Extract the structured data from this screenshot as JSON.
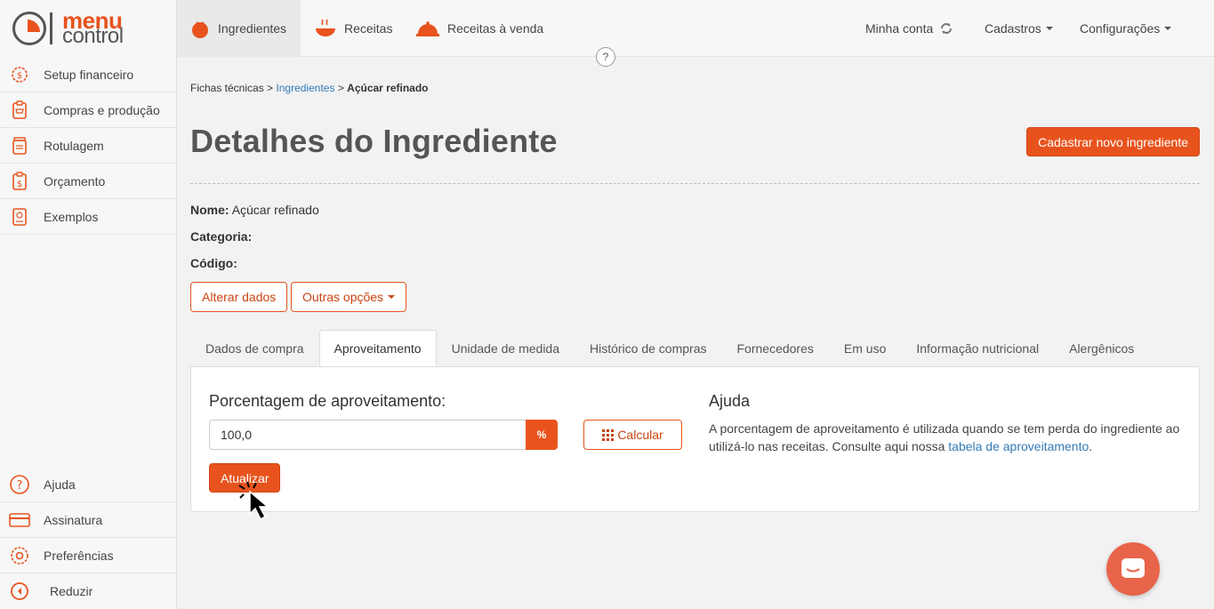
{
  "brand": {
    "line1": "menu",
    "line2": "control"
  },
  "sidebar": {
    "items": [
      {
        "label": "Setup financeiro",
        "icon": "gear-dollar-icon"
      },
      {
        "label": "Compras e produção",
        "icon": "clipboard-cart-icon"
      },
      {
        "label": "Rotulagem",
        "icon": "jar-label-icon"
      },
      {
        "label": "Orçamento",
        "icon": "clipboard-dollar-icon"
      },
      {
        "label": "Exemplos",
        "icon": "book-icon"
      }
    ],
    "bottom_items": [
      {
        "label": "Ajuda",
        "icon": "question-icon"
      },
      {
        "label": "Assinatura",
        "icon": "card-icon"
      },
      {
        "label": "Preferências",
        "icon": "gear-icon"
      },
      {
        "label": "Reduzir",
        "icon": "chevron-left-circle-icon"
      }
    ]
  },
  "topnav": {
    "tabs": [
      {
        "label": "Ingredientes",
        "icon": "tomato-icon",
        "active": true
      },
      {
        "label": "Receitas",
        "icon": "bowl-icon"
      },
      {
        "label": "Receitas à venda",
        "icon": "cloche-icon"
      }
    ],
    "right": [
      {
        "label": "Minha conta",
        "icon": "refresh-icon"
      },
      {
        "label": "Cadastros",
        "dropdown": true
      },
      {
        "label": "Configurações",
        "dropdown": true
      }
    ],
    "help": "?"
  },
  "breadcrumb": {
    "root": "Fichas técnicas",
    "sep": ">",
    "link": "Ingredientes",
    "current": "Açúcar refinado"
  },
  "page": {
    "title": "Detalhes do Ingrediente",
    "new_button": "Cadastrar novo ingrediente",
    "fields": {
      "nome_label": "Nome:",
      "nome_value": "Açúcar refinado",
      "categoria_label": "Categoria:",
      "categoria_value": "",
      "codigo_label": "Código:",
      "codigo_value": ""
    },
    "alter_button": "Alterar dados",
    "options_button": "Outras opções"
  },
  "tabs": [
    "Dados de compra",
    "Aproveitamento",
    "Unidade de medida",
    "Histórico de compras",
    "Fornecedores",
    "Em uso",
    "Informação nutricional",
    "Alergênicos"
  ],
  "active_tab": "Aproveitamento",
  "panel": {
    "label": "Porcentagem de aproveitamento:",
    "input_value": "100,0",
    "addon": "%",
    "calc_button": "Calcular",
    "update_button": "Atualizar",
    "help_title": "Ajuda",
    "help_text": "A porcentagem de aproveitamento é utilizada quando se tem perda do ingrediente ao utilizá-lo nas receitas. Consulte aqui nossa ",
    "help_link": "tabela de aproveitamento",
    "help_end": "."
  },
  "colors": {
    "accent": "#e8531d",
    "link": "#337ab7",
    "chat": "#e8644a"
  }
}
